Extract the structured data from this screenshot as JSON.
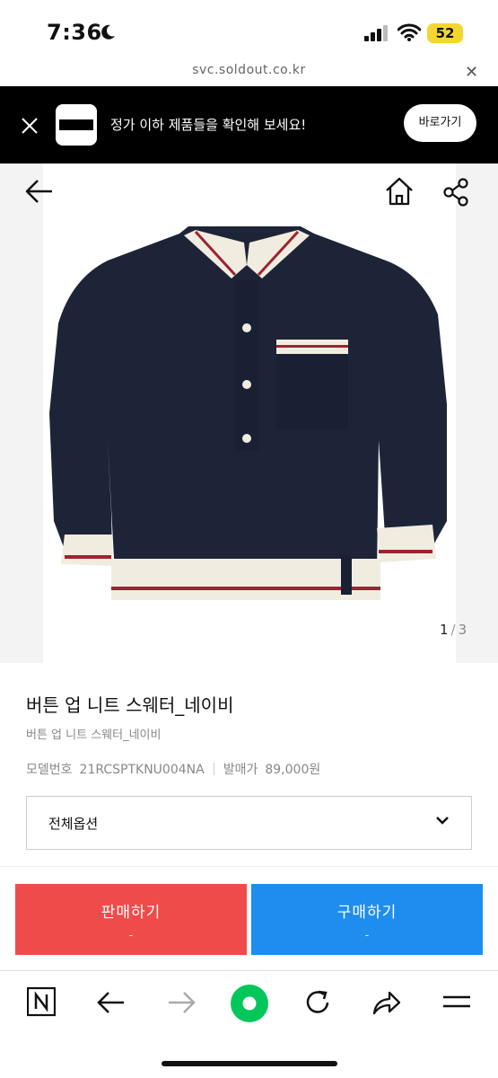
{
  "status_bar": {
    "time": "7:36",
    "battery": "52",
    "colors": {
      "battery": "#f5d631"
    }
  },
  "url_bar": {
    "url": "svc.soldout.co.kr"
  },
  "app_banner": {
    "message": "정가 이하 제품들을 확인해 보세요!",
    "button_label": "바로가기"
  },
  "gallery": {
    "current_page": "1",
    "separator": "/",
    "total_pages": "3"
  },
  "product": {
    "title": "버튼 업 니트 스웨터_네이비",
    "subtitle": "버튼 업 니트 스웨터_네이비",
    "model_label": "모델번호",
    "model_value": "21RCSPTKNU004NA",
    "price_label": "발매가",
    "price_value": "89,000원"
  },
  "options": {
    "selected": "전체옵션"
  },
  "actions": {
    "sell_label": "판매하기",
    "sell_price": "-",
    "buy_label": "구매하기",
    "buy_price": "-",
    "colors": {
      "sell": "#ef4b4b",
      "buy": "#1e8dee"
    }
  },
  "browser_toolbar": {
    "icons": [
      "naver-n-icon",
      "back-arrow-icon",
      "forward-arrow-icon",
      "green-dot-icon",
      "reload-icon",
      "share-icon",
      "menu-icon"
    ],
    "colors": {
      "green": "#03c75a"
    }
  }
}
